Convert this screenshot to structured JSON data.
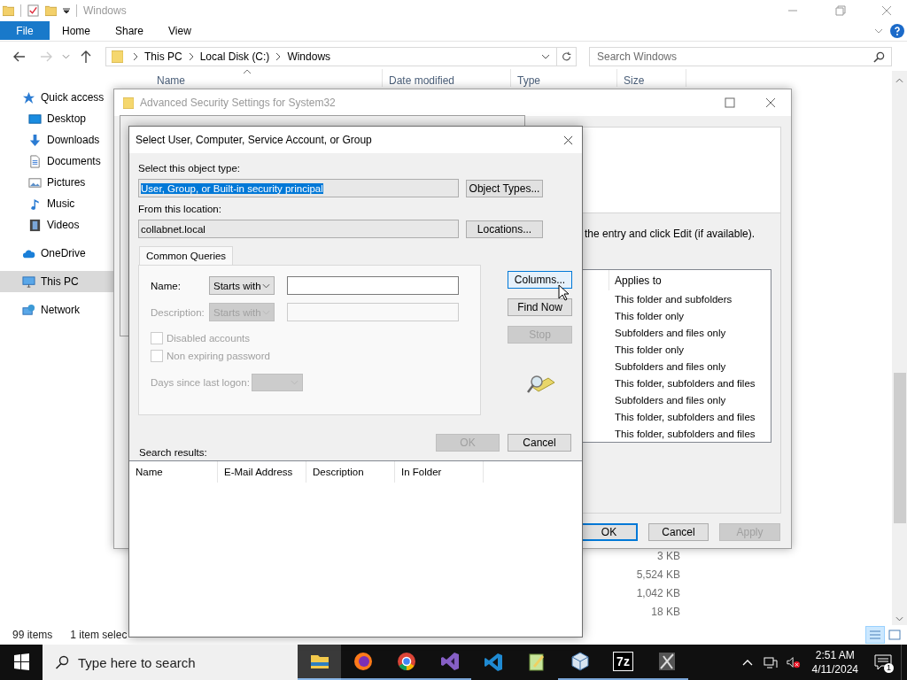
{
  "explorer": {
    "title": "Windows",
    "ribbon": [
      {
        "label": "File",
        "kind": "file"
      },
      {
        "label": "Home",
        "kind": "tab"
      },
      {
        "label": "Share",
        "kind": "tab"
      },
      {
        "label": "View",
        "kind": "tab"
      }
    ],
    "address": [
      "This PC",
      "Local Disk (C:)",
      "Windows"
    ],
    "search": {
      "placeholder": "Search Windows"
    },
    "nav_pane": [
      {
        "label": "Quick access",
        "kind": "star",
        "selected": false,
        "children": [
          {
            "label": "Desktop",
            "kind": "desktop",
            "selected": false
          },
          {
            "label": "Downloads",
            "kind": "download",
            "selected": false
          },
          {
            "label": "Documents",
            "kind": "document",
            "selected": false
          },
          {
            "label": "Pictures",
            "kind": "picture",
            "selected": false
          },
          {
            "label": "Music",
            "kind": "music",
            "selected": false
          },
          {
            "label": "Videos",
            "kind": "video",
            "selected": false
          }
        ]
      },
      {
        "label": "OneDrive",
        "kind": "cloud",
        "selected": false
      },
      {
        "label": "This PC",
        "kind": "pc",
        "selected": true
      },
      {
        "label": "Network",
        "kind": "network",
        "selected": false
      }
    ],
    "columns": [
      {
        "label": "Name",
        "sorted": true
      },
      {
        "label": "Date modified",
        "sorted": false
      },
      {
        "label": "Type",
        "sorted": false
      },
      {
        "label": "Size",
        "sorted": false
      }
    ],
    "sizes": [
      "3 KB",
      "5,524 KB",
      "1,042 KB",
      "18 KB"
    ],
    "status": [
      "99 items",
      "1 item selec"
    ]
  },
  "security_window": {
    "title": "Advanced Security Settings for System32",
    "instruction": "the entry and click Edit (if available).",
    "list_header": "Applies to",
    "rows": [
      "This folder and subfolders",
      "This folder only",
      "Subfolders and files only",
      "This folder only",
      "Subfolders and files only",
      "This folder, subfolders and files",
      "Subfolders and files only",
      "This folder, subfolders and files",
      "This folder, subfolders and files"
    ],
    "buttons": [
      {
        "label": "OK",
        "kind": "default",
        "disabled": false
      },
      {
        "label": "Cancel",
        "kind": "normal",
        "disabled": false
      },
      {
        "label": "Apply",
        "kind": "normal",
        "disabled": true
      }
    ]
  },
  "dialog": {
    "title": "Select User, Computer, Service Account, or Group",
    "object_type": {
      "label": "Select this object type:",
      "value": "User, Group, or Built-in security principal",
      "selected": true,
      "button": "Object Types..."
    },
    "location": {
      "label": "From this location:",
      "value": "collabnet.local",
      "button": "Locations..."
    },
    "tab": {
      "label": "Common Queries",
      "selected": true
    },
    "queries": [
      {
        "label": "Name:",
        "operator": "Starts with",
        "disabled": false
      },
      {
        "label": "Description:",
        "operator": "Starts with",
        "disabled": true
      }
    ],
    "checkboxes": [
      {
        "label": "Disabled accounts",
        "checked": false,
        "disabled": true
      },
      {
        "label": "Non expiring password",
        "checked": false,
        "disabled": true
      }
    ],
    "days": {
      "label": "Days since last logon:",
      "disabled": true
    },
    "side_buttons": [
      {
        "label": "Columns...",
        "focused": true,
        "disabled": false
      },
      {
        "label": "Find Now",
        "focused": false,
        "disabled": false
      },
      {
        "label": "Stop",
        "focused": false,
        "disabled": true
      }
    ],
    "buttons": [
      {
        "label": "OK",
        "disabled": true
      },
      {
        "label": "Cancel",
        "disabled": false
      }
    ],
    "results_label": "Search results:",
    "result_columns": [
      "Name",
      "E-Mail Address",
      "Description",
      "In Folder"
    ]
  },
  "taskbar": {
    "search": {
      "placeholder": "Type here to search"
    },
    "apps": [
      {
        "kind": "explorer",
        "active": true,
        "running": true
      },
      {
        "kind": "firefox",
        "active": false,
        "running": true
      },
      {
        "kind": "chrome",
        "active": false,
        "running": true
      },
      {
        "kind": "visualstudio",
        "active": false,
        "running": true
      },
      {
        "kind": "vscode",
        "active": false,
        "running": false
      },
      {
        "kind": "notepad",
        "active": false,
        "running": false
      },
      {
        "kind": "virtualbox",
        "active": false,
        "running": true
      },
      {
        "kind": "archiver",
        "label": "7z",
        "active": false,
        "running": true
      },
      {
        "kind": "tool",
        "active": false,
        "running": true
      }
    ],
    "tray": {
      "time": "2:51 AM",
      "date": "4/11/2024",
      "notifications": "1",
      "muted": true
    }
  }
}
